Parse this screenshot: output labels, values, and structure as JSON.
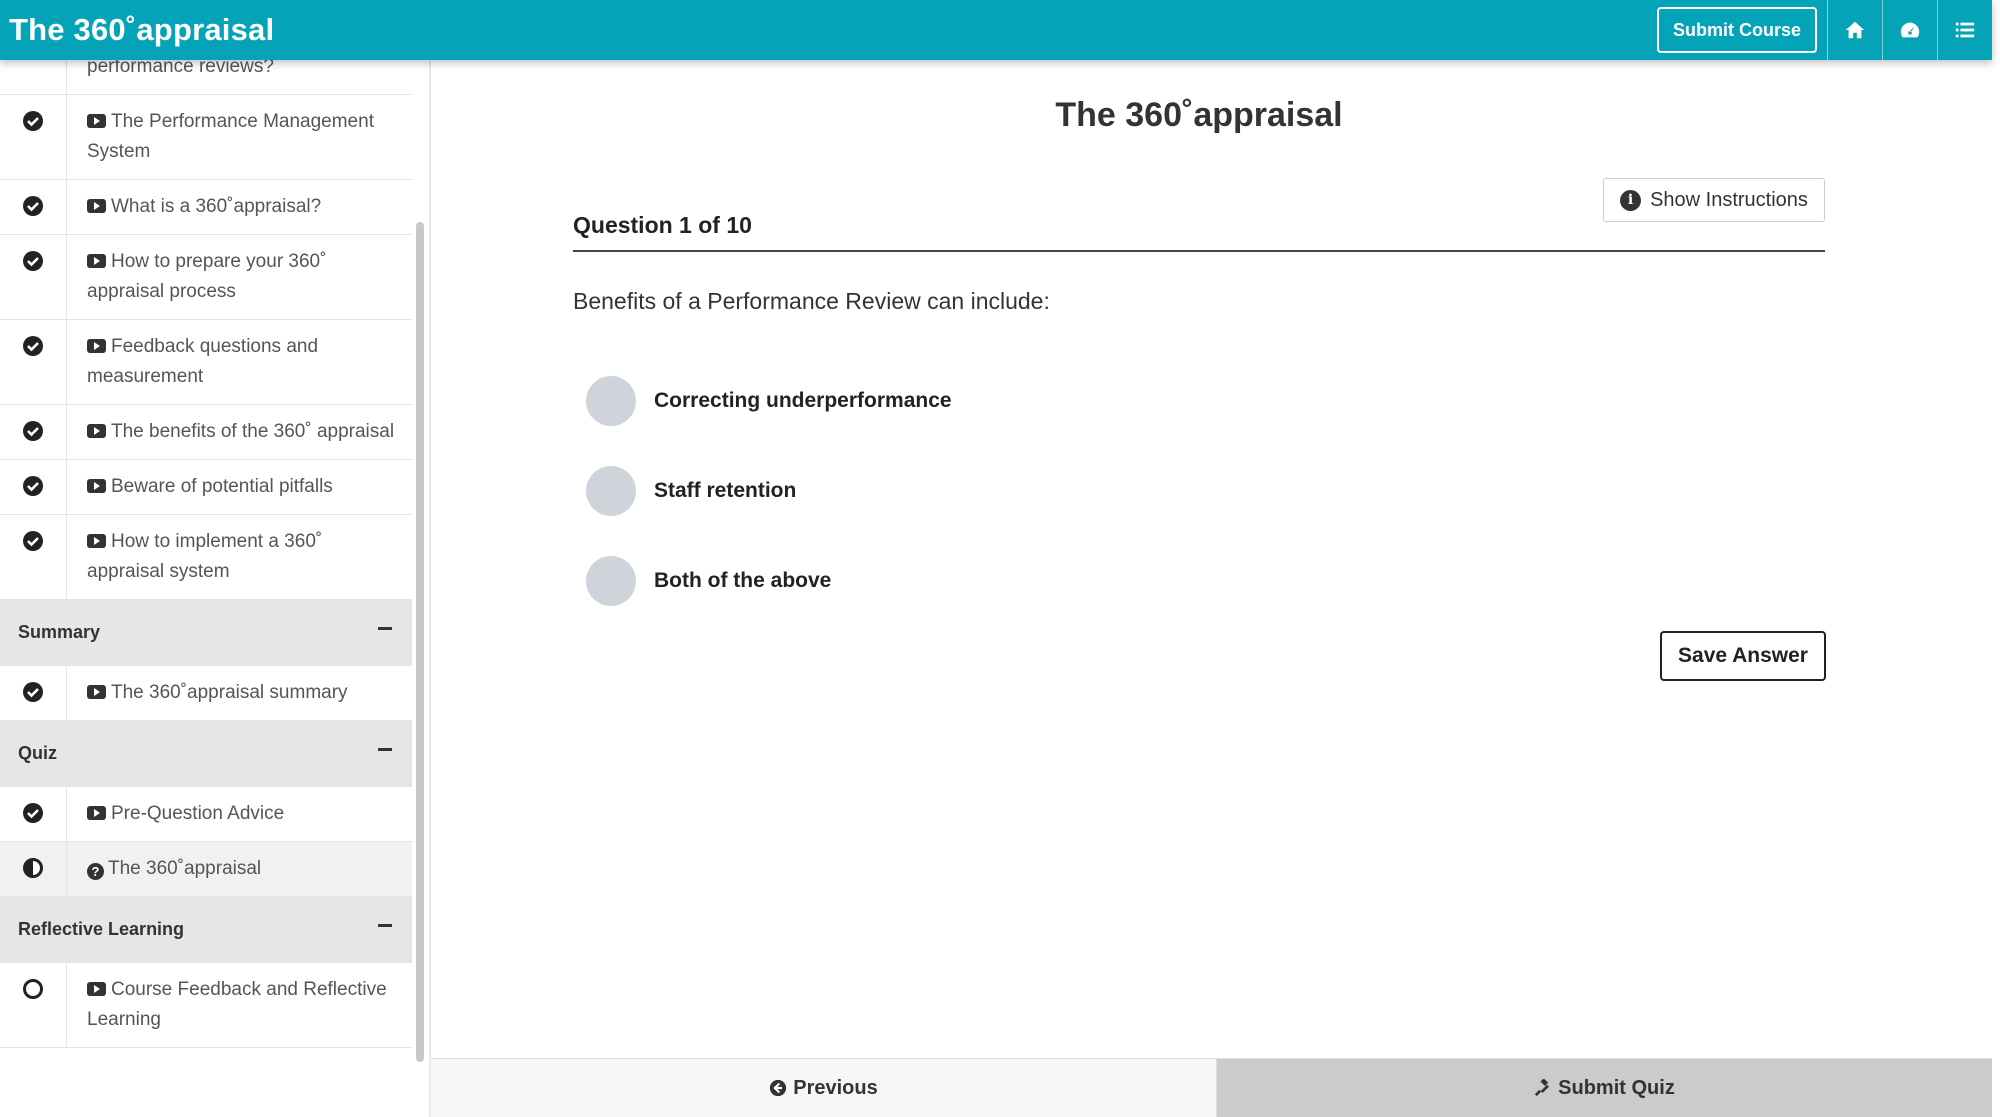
{
  "header": {
    "title": "The 360˚appraisal",
    "submit_course_label": "Submit Course",
    "icons": [
      "home-icon",
      "dashboard-icon",
      "list-icon"
    ]
  },
  "sidebar": {
    "items": [
      {
        "type": "lesson",
        "status": "complete",
        "label": "Why should we carry out performance reviews?"
      },
      {
        "type": "lesson",
        "status": "complete",
        "label": "The Performance Management System"
      },
      {
        "type": "lesson",
        "status": "complete",
        "label": "What is a 360˚appraisal?"
      },
      {
        "type": "lesson",
        "status": "complete",
        "label": "How to prepare your 360˚ appraisal process"
      },
      {
        "type": "lesson",
        "status": "complete",
        "label": "Feedback questions and measurement"
      },
      {
        "type": "lesson",
        "status": "complete",
        "label": "The benefits of the 360˚ appraisal"
      },
      {
        "type": "lesson",
        "status": "complete",
        "label": "Beware of potential pitfalls"
      },
      {
        "type": "lesson",
        "status": "complete",
        "label": "How to implement a 360˚ appraisal system"
      }
    ],
    "sections": [
      {
        "title": "Summary",
        "items": [
          {
            "status": "complete",
            "label": "The 360˚appraisal summary"
          }
        ]
      },
      {
        "title": "Quiz",
        "items": [
          {
            "status": "complete",
            "label": "Pre-Question Advice"
          },
          {
            "status": "in-progress",
            "label": "The 360˚appraisal"
          }
        ]
      },
      {
        "title": "Reflective Learning",
        "items": [
          {
            "status": "not-started",
            "label": "Course Feedback and Reflective Learning"
          }
        ]
      }
    ]
  },
  "main": {
    "title": "The 360˚appraisal",
    "show_instructions_label": "Show Instructions",
    "question_counter": "Question 1 of 10",
    "question_text": "Benefits of a Performance Review can include:",
    "options": [
      "Correcting underperformance",
      "Staff retention",
      "Both of the above"
    ],
    "save_answer_label": "Save Answer"
  },
  "footer": {
    "previous_label": "Previous",
    "submit_quiz_label": "Submit Quiz"
  }
}
